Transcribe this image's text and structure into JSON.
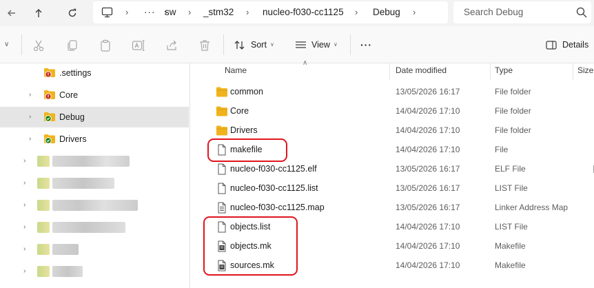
{
  "address": {
    "crumbs": [
      "sw",
      "_stm32",
      "nucleo-f030-cc1125",
      "Debug"
    ],
    "ellipsis": "···",
    "search_placeholder": "Search Debug"
  },
  "toolbar": {
    "sort_label": "Sort",
    "view_label": "View",
    "more_label": "···",
    "details_label": "Details"
  },
  "nav": {
    "items": [
      {
        "label": ".settings",
        "status": "error"
      },
      {
        "label": "Core",
        "status": "error"
      },
      {
        "label": "Debug",
        "status": "ok",
        "selected": true
      },
      {
        "label": "Drivers",
        "status": "ok"
      }
    ]
  },
  "columns": {
    "name": "Name",
    "date": "Date modified",
    "type": "Type",
    "size": "Size"
  },
  "files": [
    {
      "name": "common",
      "date": "13/05/2026 16:17",
      "type": "File folder",
      "icon": "folder-icon"
    },
    {
      "name": "Core",
      "date": "14/04/2026 17:10",
      "type": "File folder",
      "icon": "folder-icon"
    },
    {
      "name": "Drivers",
      "date": "14/04/2026 17:10",
      "type": "File folder",
      "icon": "folder-icon"
    },
    {
      "name": "makefile",
      "date": "14/04/2026 17:10",
      "type": "File",
      "icon": "file-icon"
    },
    {
      "name": "nucleo-f030-cc1125.elf",
      "date": "13/05/2026 16:17",
      "type": "ELF File",
      "icon": "file-icon"
    },
    {
      "name": "nucleo-f030-cc1125.list",
      "date": "13/05/2026 16:17",
      "type": "LIST File",
      "icon": "file-icon"
    },
    {
      "name": "nucleo-f030-cc1125.map",
      "date": "13/05/2026 16:17",
      "type": "Linker Address Map",
      "icon": "text-file-icon"
    },
    {
      "name": "objects.list",
      "date": "14/04/2026 17:10",
      "type": "LIST File",
      "icon": "file-icon"
    },
    {
      "name": "objects.mk",
      "date": "14/04/2026 17:10",
      "type": "Makefile",
      "icon": "makefile-icon"
    },
    {
      "name": "sources.mk",
      "date": "14/04/2026 17:10",
      "type": "Makefile",
      "icon": "makefile-icon"
    }
  ],
  "colors": {
    "folder": "#f0b31d",
    "highlight": "#e0141e",
    "selected": "#e5e5e5",
    "error_badge": "#c42b1c",
    "ok_badge": "#107c10"
  }
}
